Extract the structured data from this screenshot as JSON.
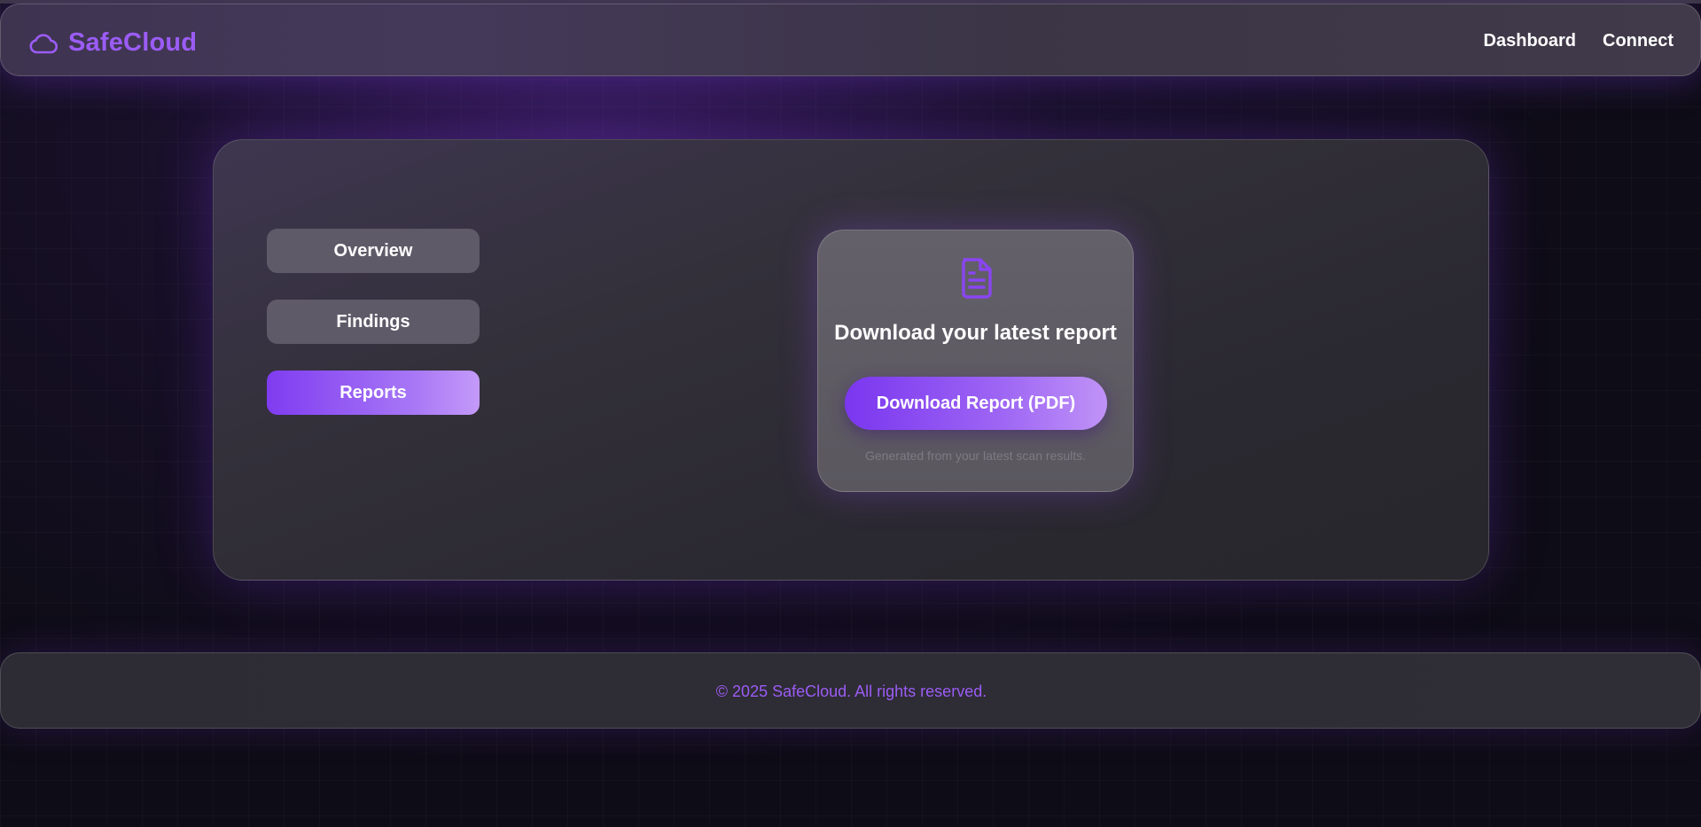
{
  "brand": {
    "name": "SafeCloud",
    "icon": "cloud-icon",
    "color": "#9b5cf5"
  },
  "nav": {
    "links": [
      {
        "label": "Dashboard"
      },
      {
        "label": "Connect"
      }
    ]
  },
  "sidebar": {
    "tabs": [
      {
        "label": "Overview",
        "active": false
      },
      {
        "label": "Findings",
        "active": false
      },
      {
        "label": "Reports",
        "active": true
      }
    ]
  },
  "report": {
    "icon": "document-icon",
    "title": "Download your latest report",
    "button_label": "Download Report (PDF)",
    "note": "Generated from your latest scan results."
  },
  "footer": {
    "text": "© 2025 SafeCloud. All rights reserved."
  },
  "colors": {
    "accent": "#7f3cf0",
    "accent_light": "#c49af8",
    "background": "#0e0c16"
  }
}
